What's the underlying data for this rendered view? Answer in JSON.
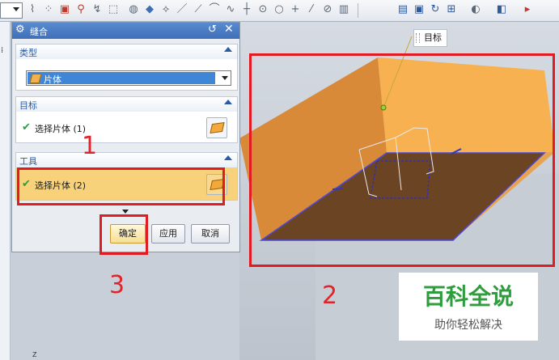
{
  "dialog": {
    "title": "缝合",
    "type_section": {
      "label": "类型",
      "selected_value": "片体"
    },
    "target_section": {
      "label": "目标",
      "selection_text": "选择片体 (1)"
    },
    "tool_section": {
      "label": "工具",
      "selection_text": "选择片体 (2)"
    },
    "buttons": {
      "ok": "确定",
      "apply": "应用",
      "cancel": "取消"
    }
  },
  "viewport": {
    "callout_label": "目标",
    "axis_label": "Z"
  },
  "annotations": {
    "marker_1": "1",
    "marker_2": "2",
    "marker_3": "3"
  },
  "watermark": {
    "title": "百科全说",
    "subtitle": "助你轻松解决"
  },
  "colors": {
    "highlight_red": "#e21b22",
    "sheet_orange": "#f7b150",
    "face_brown": "#6b4423",
    "title_blue": "#3e6fb8",
    "check_green": "#22a53a"
  },
  "icons": [
    "gear-icon",
    "reset-icon",
    "close-icon",
    "collapse-caret-icon",
    "checkmark-icon",
    "select-face-icon",
    "sheet-body-icon",
    "dropdown-arrow-icon",
    "expand-more-icon"
  ]
}
